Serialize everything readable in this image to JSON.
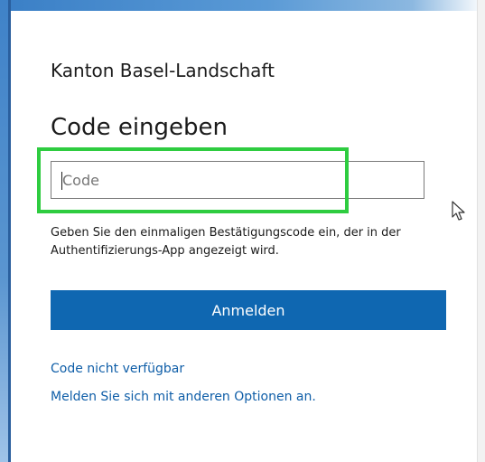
{
  "org_name": "Kanton Basel-Landschaft",
  "title": "Code eingeben",
  "code_input": {
    "placeholder": "Code",
    "value": ""
  },
  "hint_text": "Geben Sie den einmaligen Bestätigungscode ein, der in der Authentifizierungs-App angezeigt wird.",
  "login_button_label": "Anmelden",
  "links": {
    "code_unavailable": "Code nicht verfügbar",
    "other_options": "Melden Sie sich mit anderen Optionen an."
  },
  "colors": {
    "accent": "#0f67b1",
    "link": "#0f5ea8",
    "highlight": "#2ecc40"
  },
  "icons": {
    "pointer": "mouse-pointer-icon"
  }
}
